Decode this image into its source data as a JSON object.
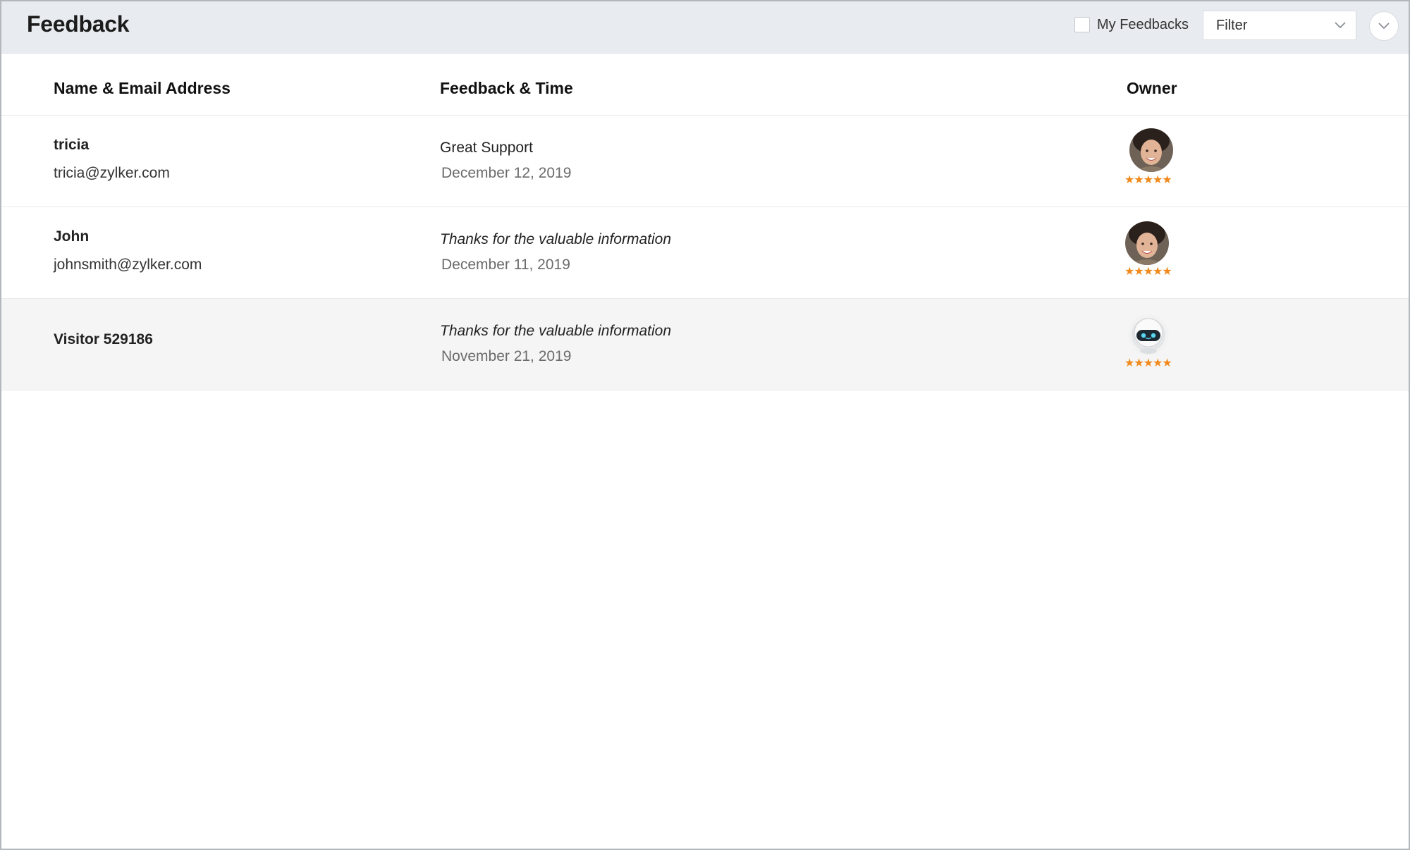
{
  "header": {
    "title": "Feedback",
    "my_feedbacks_label": "My Feedbacks",
    "my_feedbacks_checked": false,
    "filter_label": "Filter"
  },
  "table": {
    "columns": [
      "Name & Email Address",
      "Feedback & Time",
      "Owner"
    ],
    "rows": [
      {
        "name": "tricia",
        "email": "tricia@zylker.com",
        "feedback": "Great Support",
        "date": "December 12, 2019",
        "owner_avatar": "person-avatar",
        "rating": 5,
        "stars": "★★★★★"
      },
      {
        "name": "John",
        "email": "johnsmith@zylker.com",
        "feedback": "Thanks for the valuable information",
        "date": "December 11, 2019",
        "owner_avatar": "person-avatar",
        "rating": 5,
        "stars": "★★★★★"
      },
      {
        "name": "Visitor 529186",
        "email": "",
        "feedback": "Thanks for the valuable information",
        "date": "November 21, 2019",
        "owner_avatar": "bot-avatar",
        "rating": 5,
        "stars": "★★★★★"
      }
    ]
  },
  "colors": {
    "header_bg": "#e8ecf0",
    "star": "#f08a1c",
    "row_highlight": "#f5f5f5"
  }
}
